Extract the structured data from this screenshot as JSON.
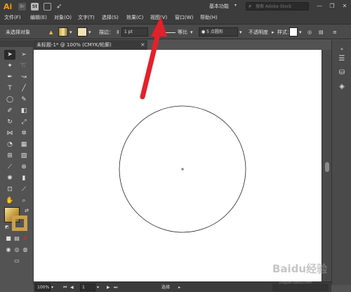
{
  "app": {
    "logo": "Ai",
    "bridge_icon": "Br",
    "stock_icon": "St",
    "workspace": "基本功能",
    "search_placeholder": "搜索 Adobe Stock"
  },
  "menu": {
    "items": [
      "文件(F)",
      "编辑(E)",
      "对象(O)",
      "文字(T)",
      "选择(S)",
      "效果(C)",
      "视图(V)",
      "窗口(W)",
      "帮助(H)"
    ]
  },
  "window_controls": {
    "minimize": "—",
    "maximize": "❐",
    "close": "✕"
  },
  "control_bar": {
    "selection_state": "未选择对象",
    "stroke_label": "描边：",
    "stroke_weight": "1 pt",
    "stroke_profile": "等比",
    "brush_label": "5 点圆形",
    "opacity_label": "不透明度",
    "style_label": "样式："
  },
  "document": {
    "tab_title": "未标题-1* @ 100% (CMYK/轮廓)",
    "close_glyph": "×"
  },
  "status_bar": {
    "zoom": "100%",
    "artboard": "1",
    "tool": "选择"
  },
  "watermark": {
    "text": "Baidu经验",
    "sub": "jingyan.baidu.com"
  },
  "colors": {
    "arrow": "#e4202a",
    "fill_gradient_start": "#f5e4a0",
    "fill_gradient_end": "#8a6a25",
    "app_logo": "#ff9a00"
  },
  "icons": {
    "toolbar": [
      "selection-tool-icon",
      "direct-selection-tool-icon",
      "magic-wand-icon",
      "lasso-icon",
      "pen-tool-icon",
      "curvature-tool-icon",
      "type-tool-icon",
      "line-tool-icon",
      "ellipse-tool-icon",
      "paintbrush-icon",
      "shaper-tool-icon",
      "eraser-icon",
      "rotate-tool-icon",
      "scale-tool-icon",
      "width-tool-icon",
      "puppet-warp-icon",
      "shape-builder-icon",
      "perspective-grid-icon",
      "mesh-tool-icon",
      "gradient-tool-icon",
      "eyedropper-icon",
      "blend-tool-icon",
      "symbol-sprayer-icon",
      "column-graph-icon",
      "artboard-tool-icon",
      "slice-tool-icon",
      "hand-tool-icon",
      "zoom-tool-icon"
    ]
  }
}
